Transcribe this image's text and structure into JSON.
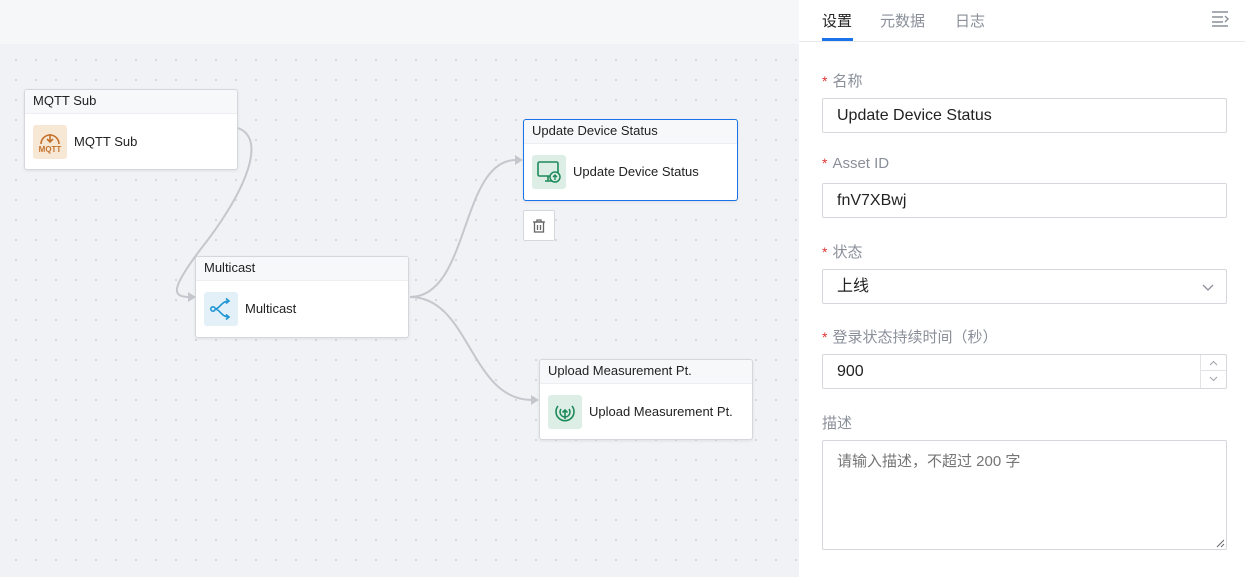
{
  "canvas": {
    "nodes": [
      {
        "id": "mqtt-sub",
        "header": "MQTT Sub",
        "label": "MQTT Sub",
        "icon": "mqtt-icon"
      },
      {
        "id": "multicast",
        "header": "Multicast",
        "label": "Multicast",
        "icon": "multicast-icon"
      },
      {
        "id": "update-device-status",
        "header": "Update Device Status",
        "label": "Update Device Status",
        "icon": "device-status-icon",
        "selected": true
      },
      {
        "id": "upload-measurement",
        "header": "Upload Measurement Pt.",
        "label": "Upload Measurement Pt.",
        "icon": "measurement-upload-icon"
      }
    ],
    "delete_icon": "trash-icon"
  },
  "panel": {
    "tabs": [
      {
        "label": "设置",
        "active": true
      },
      {
        "label": "元数据",
        "active": false
      },
      {
        "label": "日志",
        "active": false
      }
    ],
    "menu_icon": "collapse-menu-icon",
    "fields": {
      "name": {
        "label": "名称",
        "required": true,
        "value": "Update Device Status"
      },
      "asset_id": {
        "label": "Asset ID",
        "required": true,
        "value": "fnV7XBwj"
      },
      "status": {
        "label": "状态",
        "required": true,
        "value": "上线"
      },
      "duration": {
        "label": "登录状态持续时间（秒）",
        "required": true,
        "value": "900"
      },
      "description": {
        "label": "描述",
        "required": false,
        "placeholder": "请输入描述，不超过 200 字"
      }
    },
    "required_mark": "*"
  },
  "colors": {
    "accent": "#1a73e8",
    "required": "#e03535",
    "canvas_bg": "#f1f2f5",
    "mqtt_icon_bg": "#f7e8d6",
    "multicast_icon": "#2196d3",
    "green_icon": "#1e8a5a"
  }
}
